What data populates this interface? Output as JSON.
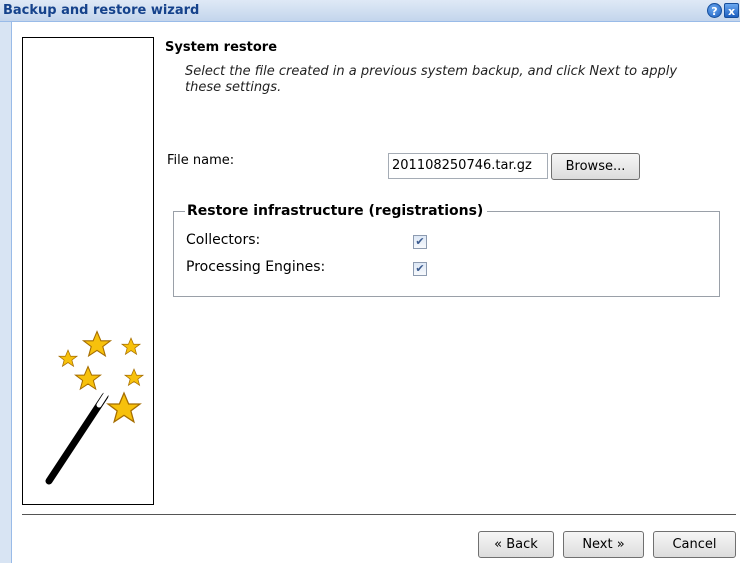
{
  "window": {
    "title": "Backup and restore wizard",
    "help_label": "?",
    "close_label": "x"
  },
  "step": {
    "title": "System restore",
    "description": "Select the file created in a previous system backup, and click Next to apply these settings."
  },
  "file": {
    "label": "File name:",
    "value": "201108250746.tar.gz",
    "browse_label": "Browse..."
  },
  "restore": {
    "legend": "Restore infrastructure (registrations)",
    "options": [
      {
        "label": "Collectors:",
        "checked": true
      },
      {
        "label": "Processing Engines:",
        "checked": true
      }
    ]
  },
  "footer": {
    "back_label": "« Back",
    "next_label": "Next »",
    "cancel_label": "Cancel"
  },
  "icons": {
    "wand": "magic-wand-icon",
    "help": "help-icon",
    "close": "close-icon",
    "check": "✔"
  },
  "colors": {
    "titlebar": "#c3d5ec",
    "title_text": "#15428b",
    "star": "#f7c10c"
  }
}
